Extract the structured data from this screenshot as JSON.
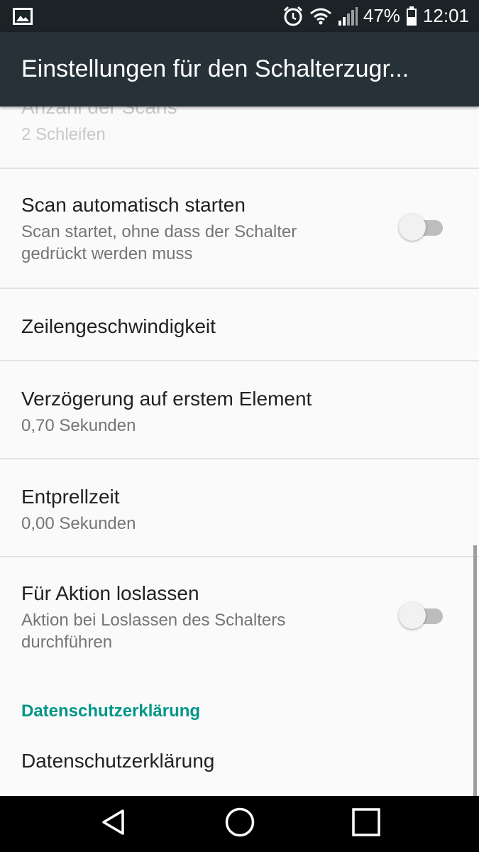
{
  "status_bar": {
    "battery_percent": "47%",
    "time": "12:01",
    "icons": [
      "gallery-icon",
      "alarm-icon",
      "wifi-icon",
      "signal-icon",
      "battery-icon"
    ]
  },
  "app_bar": {
    "title": "Einstellungen für den Schalterzugr..."
  },
  "preferences": {
    "scan_count": {
      "title": "Anzahl der Scans",
      "summary": "2 Schleifen"
    },
    "auto_start": {
      "title": "Scan automatisch starten",
      "summary": "Scan startet, ohne dass der Schalter gedrückt werden muss",
      "enabled": false
    },
    "line_speed": {
      "title": "Zeilengeschwindigkeit"
    },
    "first_item_delay": {
      "title": "Verzögerung auf erstem Element",
      "summary": "0,70 Sekunden"
    },
    "debounce": {
      "title": "Entprellzeit",
      "summary": "0,00 Sekunden"
    },
    "action_on_release": {
      "title": "Für Aktion loslassen",
      "summary": "Aktion bei Loslassen des Schalters durchführen",
      "enabled": false
    }
  },
  "privacy": {
    "category_label": "Datenschutzerklärung",
    "item_title": "Datenschutzerklärung"
  },
  "nav_bar": {
    "buttons": [
      "back-icon",
      "home-icon",
      "recents-icon"
    ]
  },
  "colors": {
    "status_bar": "#1b2327",
    "app_bar": "#263238",
    "accent": "#009688",
    "background": "#fafafa"
  }
}
